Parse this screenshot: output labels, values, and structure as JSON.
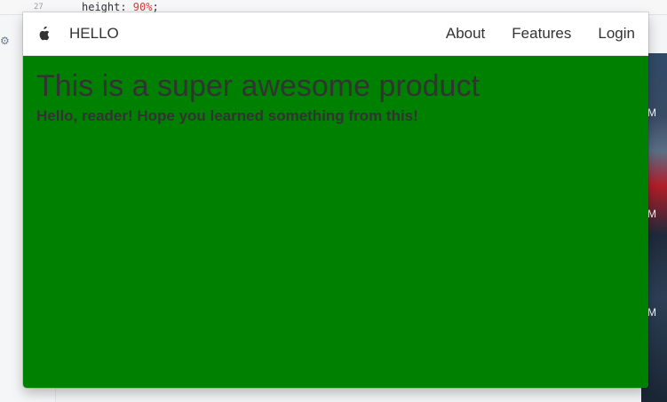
{
  "editor": {
    "line_number": "27",
    "code_prefix": "height: ",
    "code_value": "90%",
    "code_suffix": ";"
  },
  "background": {
    "marker_1": "M",
    "marker_2": "M",
    "marker_3": "M"
  },
  "navbar": {
    "brand": "HELLO",
    "links": [
      "About",
      "Features",
      "Login"
    ],
    "logo_icon": "apple-icon"
  },
  "hero": {
    "title": "This is a super awesome product",
    "subtitle": "Hello, reader! Hope you learned something from this!",
    "background_color": "#008000",
    "text_color": "#333333"
  }
}
